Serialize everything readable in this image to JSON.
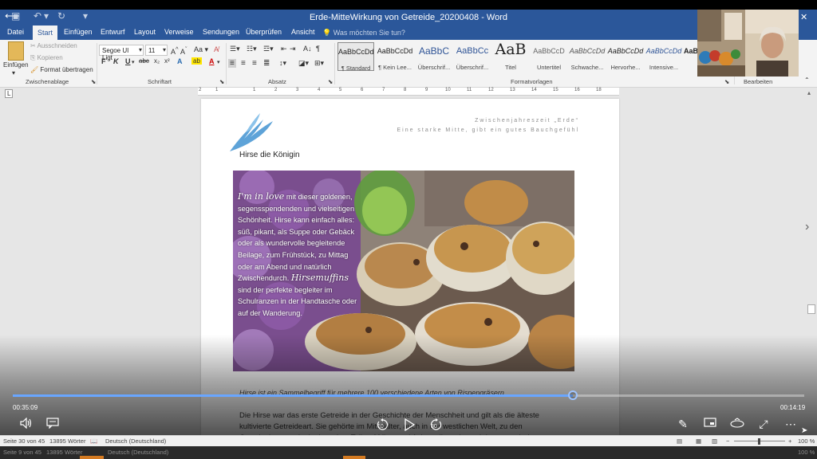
{
  "window": {
    "title": "Erde-MitteWirkung von Getreide_20200408 - Word"
  },
  "tabs": [
    "Datei",
    "Start",
    "Einfügen",
    "Entwurf",
    "Layout",
    "Verweise",
    "Sendungen",
    "Überprüfen",
    "Ansicht"
  ],
  "active_tab": "Start",
  "tell_me_placeholder": "Was möchten Sie tun?",
  "ribbon": {
    "clipboard": {
      "paste": "Einfügen",
      "cut": "Ausschneiden",
      "copy": "Kopieren",
      "format_painter": "Format übertragen",
      "label": "Zwischenablage"
    },
    "font": {
      "family": "Segoe UI Ligt",
      "size": "11",
      "label": "Schriftart"
    },
    "paragraph_label": "Absatz",
    "styles": [
      {
        "sample": "AaBbCcDd",
        "name": "¶ Standard"
      },
      {
        "sample": "AaBbCcDd",
        "name": "¶ Kein Lee..."
      },
      {
        "sample": "AaBbC",
        "name": "Überschrif..."
      },
      {
        "sample": "AaBbCc",
        "name": "Überschrif..."
      },
      {
        "sample": "AaB",
        "name": "Titel"
      },
      {
        "sample": "AaBbCcD",
        "name": "Untertitel"
      },
      {
        "sample": "AaBbCcDd",
        "name": "Schwache..."
      },
      {
        "sample": "AaBbCcDd",
        "name": "Hervorhe..."
      },
      {
        "sample": "AaBbCcDd",
        "name": "Intensive..."
      },
      {
        "sample": "AaBb",
        "name": ""
      }
    ],
    "styles_label": "Formatvorlagen",
    "editing_label": "Bearbeiten"
  },
  "ruler_numbers": [
    "2",
    "1",
    "1",
    "2",
    "3",
    "4",
    "5",
    "6",
    "7",
    "8",
    "9",
    "10",
    "11",
    "12",
    "13",
    "14",
    "15",
    "16",
    "18"
  ],
  "document": {
    "header_line1": "Zwischenjahreszeit „Erde“",
    "header_line2": "Eine starke Mitte, gibt ein gutes Bauchgefühl",
    "heading": "Hirse die Königin",
    "photo_text": {
      "love_phrase": "I'm in love",
      "text1": " mit dieser goldenen, segensspendenden und vielseitigen Schönheit. Hirse kann einfach alles: süß, pikant, als Suppe oder Gebäck oder als wundervolle begleitende Beilage, zum Frühstück, zu Mittag oder am Abend und natürlich Zwischendurch. ",
      "highlight": "Hirsemuffins",
      "text2": " sind der perfekte begleiter im Schulranzen in der Handtasche oder auf der Wanderung."
    },
    "caption": "Hirse ist ein Sammelbegriff für mehrere 100 verschiedene Arten von Rispengräsern",
    "body": "Die Hirse war das erste Getreide in der Geschichte der Menschheit und gilt als die älteste kultivierte Getreideart. Sie gehörte im Mittelalter, auch in der westlichen Welt, zu den Grundnahrungsmitteln. In weiten Teilen Afrikas und Asiens dient sie auch heute noch dazu. Goldhirse ist hierzulande die"
  },
  "player": {
    "elapsed": "00:35:09",
    "remaining": "00:14:19",
    "progress_fraction": 0.708,
    "skip_back_seconds": "10",
    "skip_forward_seconds": "30"
  },
  "status": {
    "page": "Seite 30 von 45",
    "words": "13895 Wörter",
    "language": "Deutsch (Deutschland)",
    "zoom": "100 %"
  },
  "status_lower": {
    "page": "Seite 9 von 45",
    "words": "13895 Wörter",
    "language": "Deutsch (Deutschland)",
    "zoom": "100 %"
  }
}
